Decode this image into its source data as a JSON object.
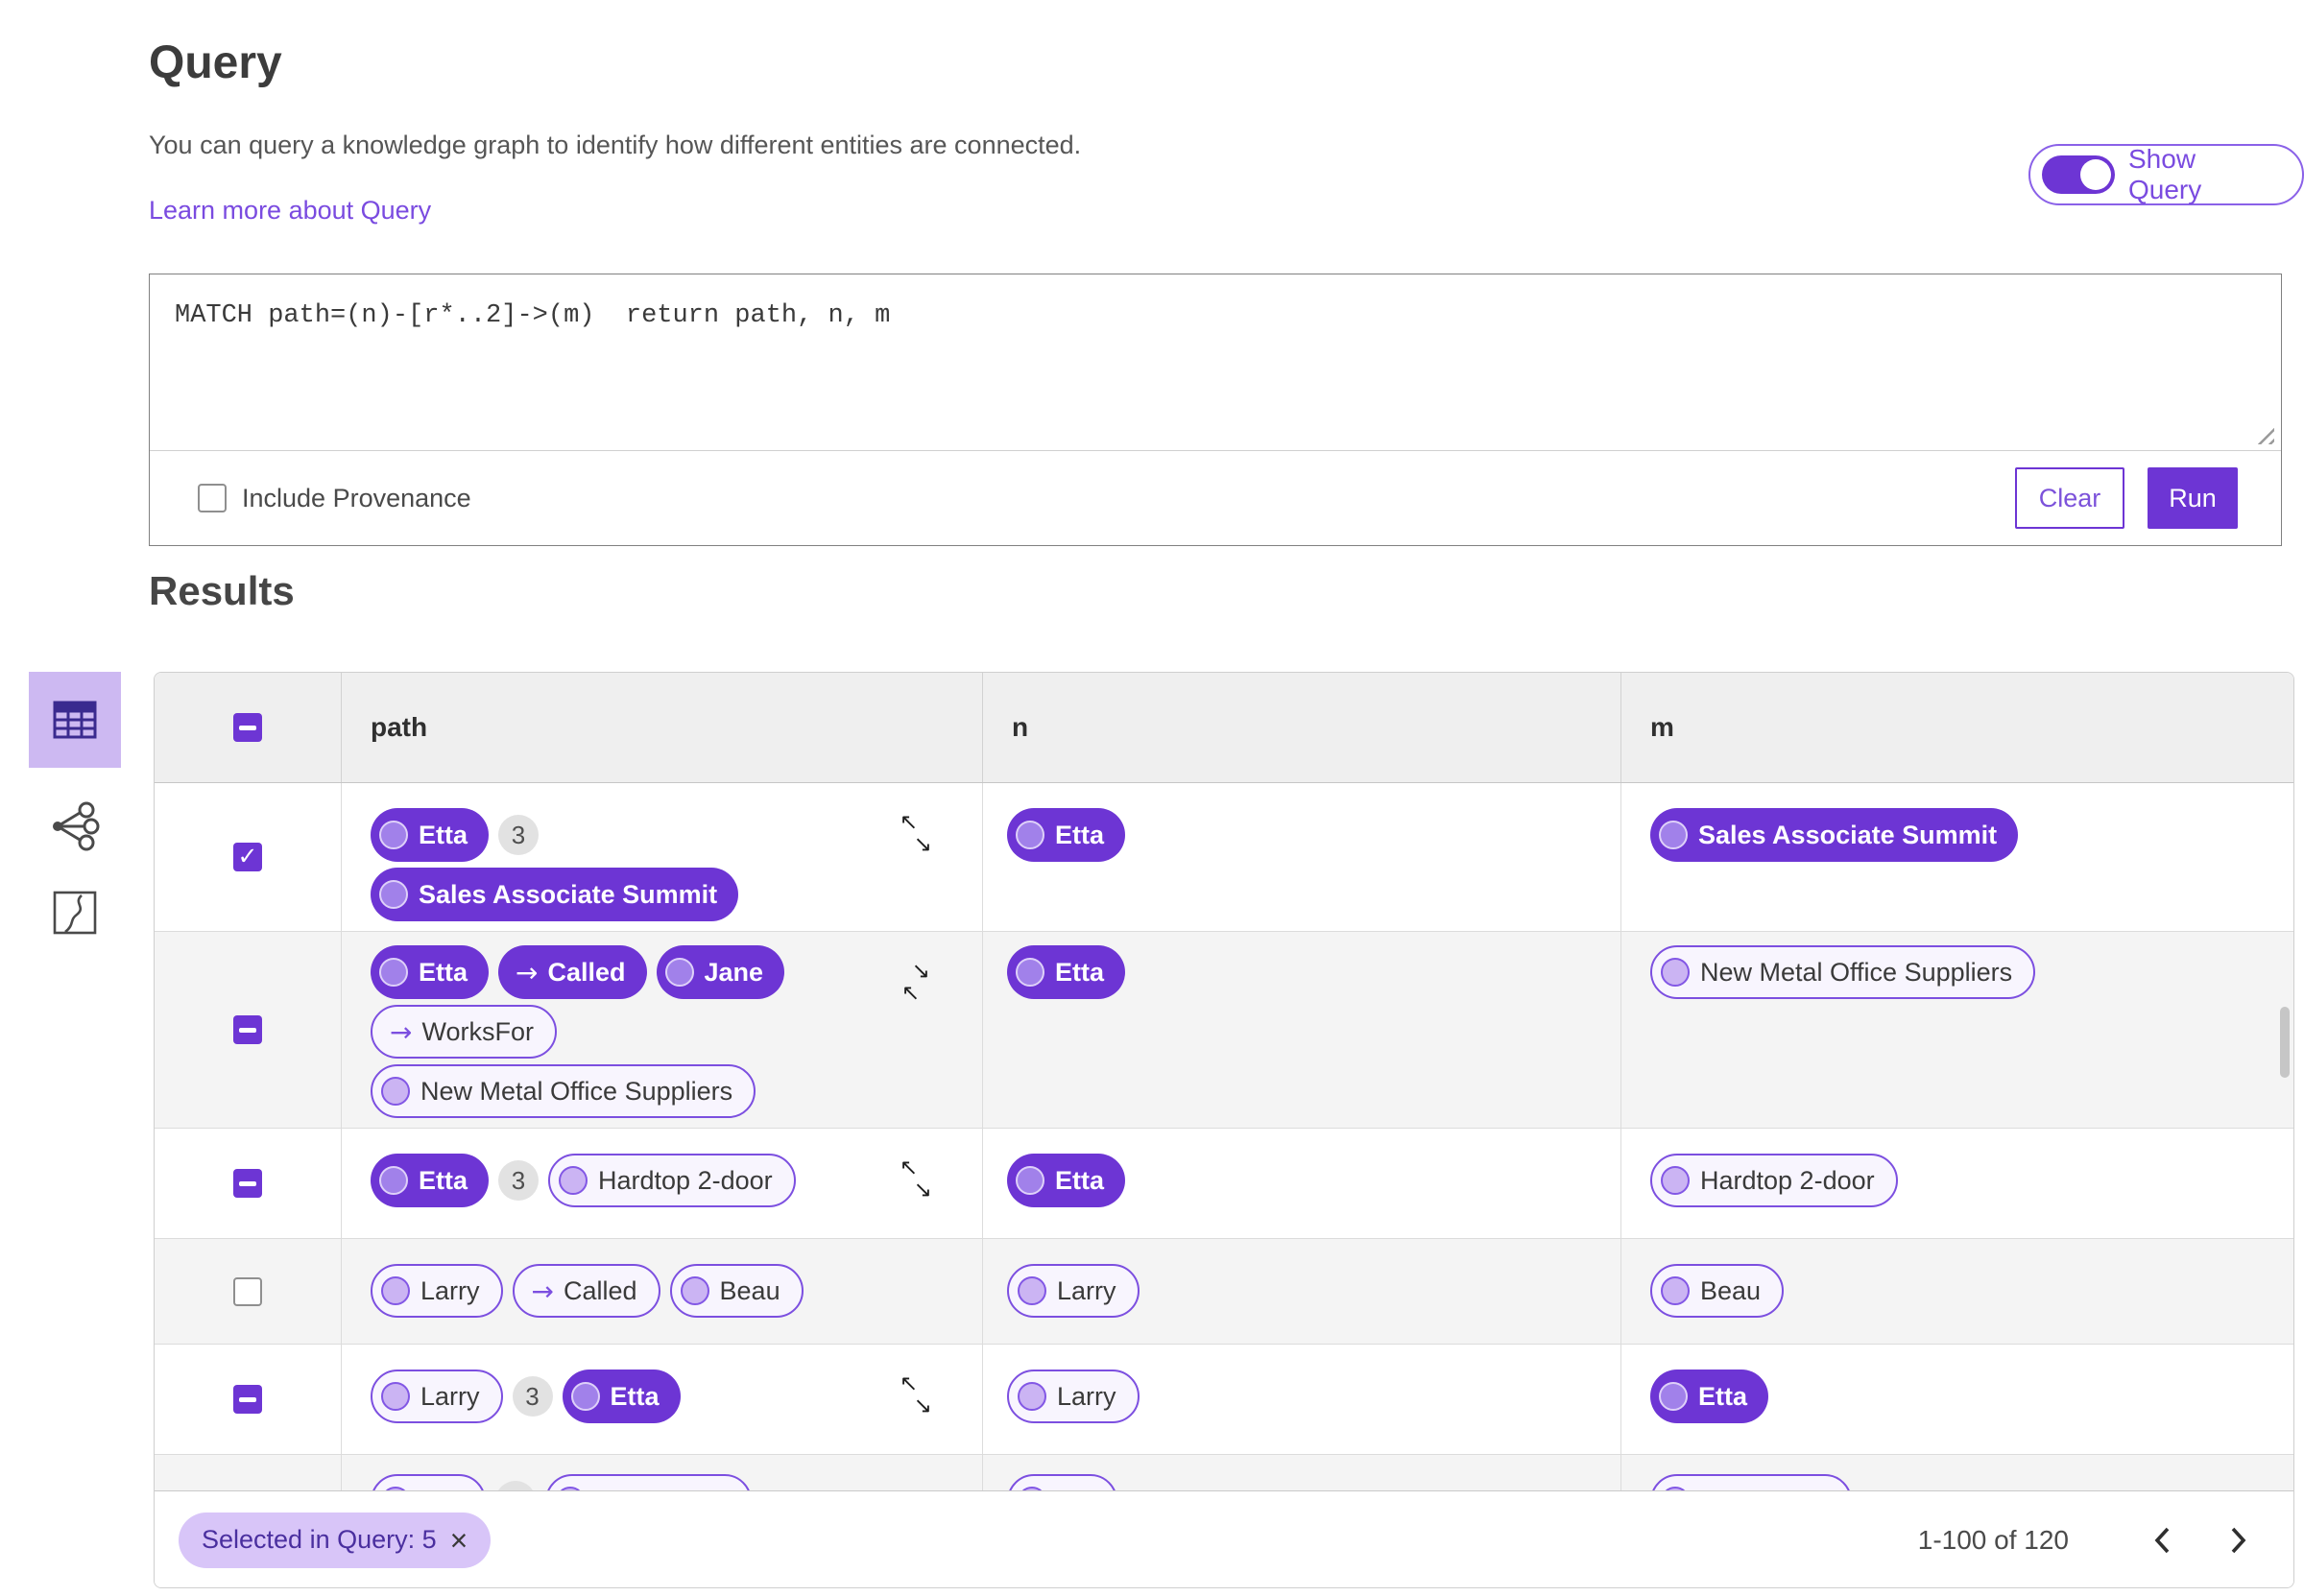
{
  "header": {
    "title": "Query",
    "description": "You can query a knowledge graph to identify how different entities are connected.",
    "learn_more_link": "Learn more about Query",
    "show_query_label": "Show Query",
    "show_query_on": true
  },
  "query_editor": {
    "query_text": "MATCH path=(n)-[r*..2]->(m)  return path, n, m",
    "include_provenance_label": "Include Provenance",
    "include_provenance_checked": false,
    "clear_button": "Clear",
    "run_button": "Run"
  },
  "results": {
    "heading": "Results",
    "view_switcher": [
      {
        "name": "table-view",
        "selected": true
      },
      {
        "name": "graph-view",
        "selected": false
      },
      {
        "name": "map-view",
        "selected": false
      }
    ],
    "table": {
      "columns": [
        "path",
        "n",
        "m"
      ],
      "header_checkbox": "indeterminate",
      "rows": [
        {
          "checkbox": "checked",
          "resize": "expand",
          "path": [
            [
              {
                "kind": "node",
                "variant": "solid",
                "label": "Etta"
              },
              {
                "kind": "count",
                "label": "3"
              }
            ],
            [
              {
                "kind": "node",
                "variant": "solid",
                "label": "Sales Associate Summit"
              }
            ]
          ],
          "n": [
            {
              "kind": "node",
              "variant": "solid",
              "label": "Etta"
            }
          ],
          "m": [
            {
              "kind": "node",
              "variant": "solid",
              "label": "Sales Associate Summit"
            }
          ]
        },
        {
          "checkbox": "indeterminate",
          "resize": "collapse",
          "path": [
            [
              {
                "kind": "node",
                "variant": "solid",
                "label": "Etta"
              },
              {
                "kind": "edge",
                "variant": "solid",
                "label": "Called"
              },
              {
                "kind": "node",
                "variant": "solid",
                "label": "Jane"
              }
            ],
            [
              {
                "kind": "edge",
                "variant": "outline",
                "label": "WorksFor"
              }
            ],
            [
              {
                "kind": "node",
                "variant": "outline",
                "label": "New Metal Office Suppliers"
              }
            ]
          ],
          "n": [
            {
              "kind": "node",
              "variant": "solid",
              "label": "Etta"
            }
          ],
          "m": [
            {
              "kind": "node",
              "variant": "outline",
              "label": "New Metal Office Suppliers"
            }
          ]
        },
        {
          "checkbox": "indeterminate",
          "resize": "expand",
          "path": [
            [
              {
                "kind": "node",
                "variant": "solid",
                "label": "Etta"
              },
              {
                "kind": "count",
                "label": "3"
              },
              {
                "kind": "node",
                "variant": "outline",
                "label": "Hardtop 2-door"
              }
            ]
          ],
          "n": [
            {
              "kind": "node",
              "variant": "solid",
              "label": "Etta"
            }
          ],
          "m": [
            {
              "kind": "node",
              "variant": "outline",
              "label": "Hardtop 2-door"
            }
          ]
        },
        {
          "checkbox": "unchecked",
          "path": [
            [
              {
                "kind": "node",
                "variant": "outline",
                "label": "Larry"
              },
              {
                "kind": "edge",
                "variant": "outline",
                "label": "Called"
              },
              {
                "kind": "node",
                "variant": "outline",
                "label": "Beau"
              }
            ]
          ],
          "n": [
            {
              "kind": "node",
              "variant": "outline",
              "label": "Larry"
            }
          ],
          "m": [
            {
              "kind": "node",
              "variant": "outline",
              "label": "Beau"
            }
          ]
        },
        {
          "checkbox": "indeterminate",
          "resize": "expand",
          "path": [
            [
              {
                "kind": "node",
                "variant": "outline",
                "label": "Larry"
              },
              {
                "kind": "count",
                "label": "3"
              },
              {
                "kind": "node",
                "variant": "solid",
                "label": "Etta"
              }
            ]
          ],
          "n": [
            {
              "kind": "node",
              "variant": "outline",
              "label": "Larry"
            }
          ],
          "m": [
            {
              "kind": "node",
              "variant": "solid",
              "label": "Etta"
            }
          ]
        },
        {
          "checkbox": "unchecked",
          "clipped": true,
          "path": [
            [
              {
                "kind": "node",
                "variant": "outline",
                "label": ""
              },
              {
                "kind": "count",
                "label": ""
              },
              {
                "kind": "node",
                "variant": "outline",
                "label": ""
              }
            ]
          ],
          "n": [
            {
              "kind": "node",
              "variant": "outline",
              "label": ""
            }
          ],
          "m": [
            {
              "kind": "node",
              "variant": "outline",
              "label": ""
            }
          ]
        }
      ]
    },
    "footer": {
      "selected_chip_label": "Selected in Query: 5",
      "pagination_label": "1-100 of 120"
    }
  },
  "icons": {
    "edge_arrow": "→",
    "arrow_up_left": "↖",
    "arrow_down_right": "↘",
    "close_icon": "×"
  },
  "colors": {
    "primary_purple": "#6d35d4",
    "link_purple": "#7a4be0",
    "outline_pill_border": "#7c4fe0",
    "chip_background": "#d8c5f8",
    "row_stripe": "#f4f4f4"
  }
}
